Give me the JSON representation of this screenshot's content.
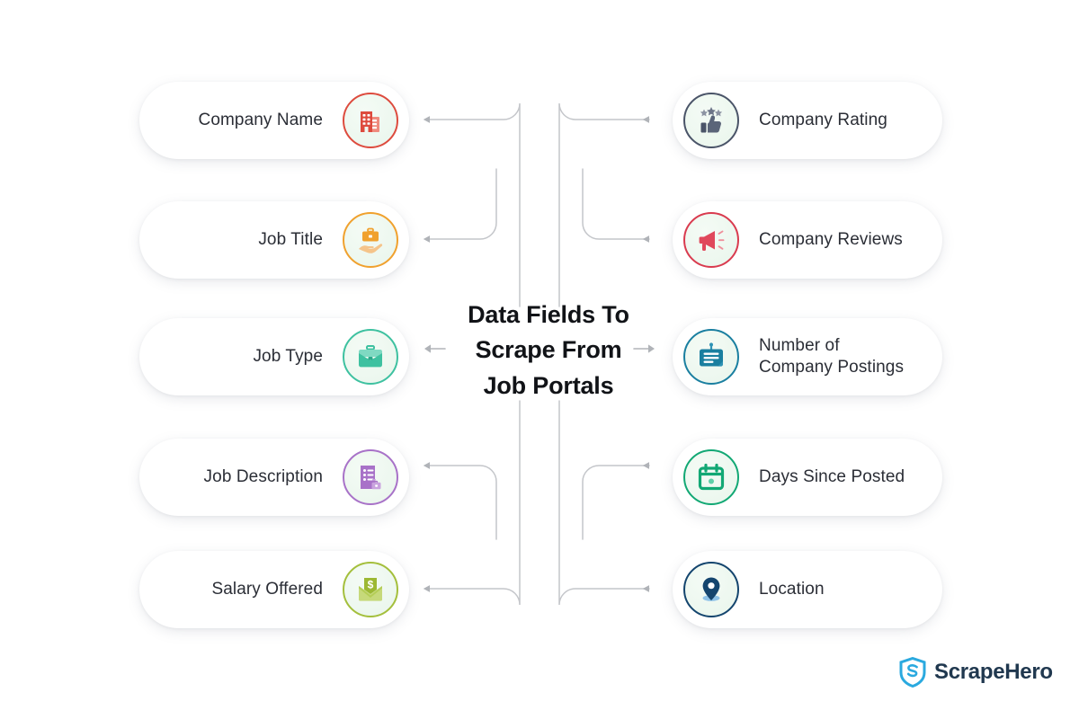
{
  "title": {
    "line1": "Data Fields To",
    "line2": "Scrape From",
    "line3": "Job Portals"
  },
  "colors": {
    "company_name": "#dd4b3e",
    "job_title": "#f0a12e",
    "job_type": "#3ec1a0",
    "job_description": "#a872c8",
    "salary_offered": "#a4bf3c",
    "company_rating": "#4a5468",
    "company_reviews": "#d93b4f",
    "company_postings": "#1a7fa0",
    "days_since_posted": "#12a874",
    "location": "#14456e",
    "connector": "#b8babf",
    "text": "#2b2e36",
    "brand": "#20384f",
    "brand_accent": "#2aa9df"
  },
  "left_fields": [
    {
      "label": "Company Name",
      "icon": "office-building-icon",
      "color": "#dd4b3e"
    },
    {
      "label": "Job Title",
      "icon": "hand-holding-briefcase-icon",
      "color": "#f0a12e"
    },
    {
      "label": "Job Type",
      "icon": "briefcase-icon",
      "color": "#3ec1a0"
    },
    {
      "label": "Job Description",
      "icon": "document-briefcase-icon",
      "color": "#a872c8"
    },
    {
      "label": "Salary Offered",
      "icon": "salary-envelope-icon",
      "color": "#a4bf3c"
    }
  ],
  "right_fields": [
    {
      "label": "Company Rating",
      "icon": "thumbs-up-stars-icon",
      "color": "#4a5468"
    },
    {
      "label": "Company Reviews",
      "icon": "megaphone-icon",
      "color": "#d93b4f"
    },
    {
      "label": "Number of\nCompany Postings",
      "icon": "job-posting-board-icon",
      "color": "#1a7fa0"
    },
    {
      "label": "Days Since Posted",
      "icon": "calendar-icon",
      "color": "#12a874"
    },
    {
      "label": "Location",
      "icon": "map-pin-icon",
      "color": "#14456e"
    }
  ],
  "logo": {
    "text": "ScrapeHero",
    "mark": "shield-s-icon"
  }
}
